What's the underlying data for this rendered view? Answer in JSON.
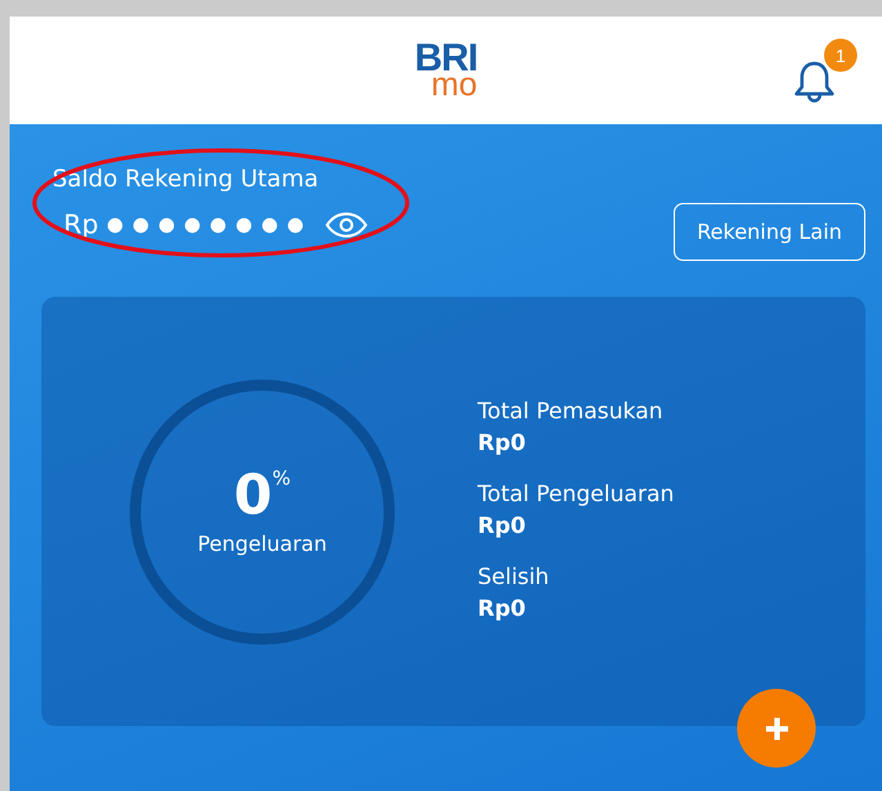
{
  "header": {
    "logo_top": "BRI",
    "logo_bottom": "mo",
    "notification_count": "1"
  },
  "balance": {
    "title": "Saldo Rekening Utama",
    "currency": "Rp",
    "masked_value": "● ● ● ● ● ● ● ●",
    "other_accounts_button": "Rekening Lain"
  },
  "summary": {
    "percent": "0",
    "percent_sign": "%",
    "percent_label": "Pengeluaran",
    "level": 0,
    "items": [
      {
        "label": "Total Pemasukan",
        "value": "Rp0"
      },
      {
        "label": "Total Pengeluaran",
        "value": "Rp0"
      },
      {
        "label": "Selisih",
        "value": "Rp0"
      }
    ]
  }
}
